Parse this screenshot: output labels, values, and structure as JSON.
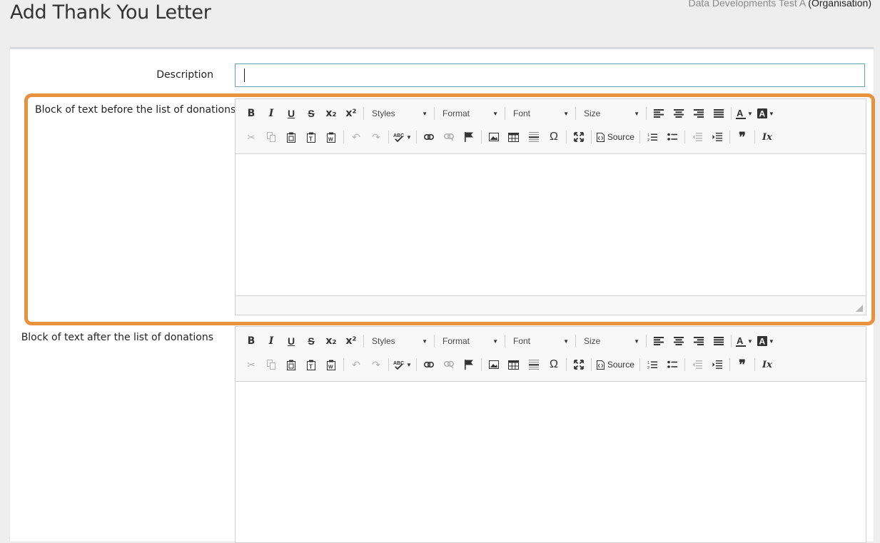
{
  "header": {
    "title": "Add Thank You Letter",
    "org_name": "Data Developments Test A",
    "org_type": "(Organisation)"
  },
  "form": {
    "description_label": "Description",
    "description_value": "",
    "before_label": "Block of text before the list of donations",
    "after_label": "Block of text after the list of donations"
  },
  "toolbar": {
    "bold": "B",
    "italic": "I",
    "underline": "U",
    "strike": "S",
    "subscript": "x₂",
    "superscript": "x²",
    "styles": "Styles",
    "format": "Format",
    "font": "Font",
    "size": "Size",
    "source": "Source",
    "omega": "Ω",
    "quote": "❞",
    "remove_format": "Ix"
  },
  "colors": {
    "highlight": "#e8923f",
    "input_border": "#6b9fb8"
  }
}
